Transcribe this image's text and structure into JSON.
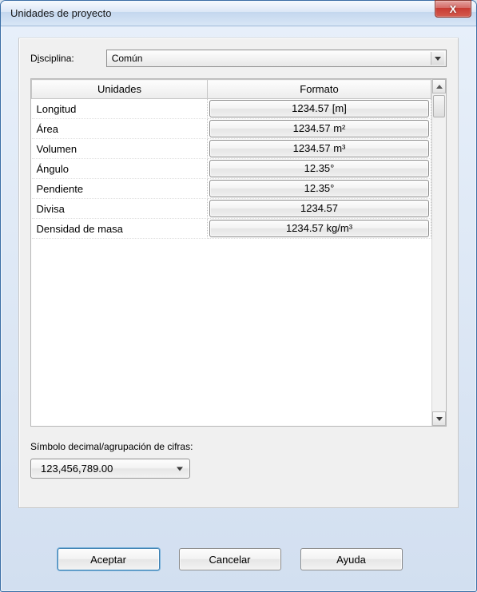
{
  "window": {
    "title": "Unidades de proyecto"
  },
  "discipline": {
    "label_pre": "D",
    "label_ul": "i",
    "label_post": "sciplina:",
    "value": "Común"
  },
  "table": {
    "header_units": "Unidades",
    "header_format": "Formato",
    "rows": [
      {
        "name": "Longitud",
        "format": "1234.57 [m]"
      },
      {
        "name": "Área",
        "format": "1234.57 m²"
      },
      {
        "name": "Volumen",
        "format": "1234.57 m³"
      },
      {
        "name": "Ángulo",
        "format": "12.35°"
      },
      {
        "name": "Pendiente",
        "format": "12.35°"
      },
      {
        "name": "Divisa",
        "format": "1234.57"
      },
      {
        "name": "Densidad de masa",
        "format": "1234.57 kg/m³"
      }
    ]
  },
  "decimal": {
    "label": "Símbolo decimal/agrupación de cifras:",
    "value": "123,456,789.00"
  },
  "buttons": {
    "ok": "Aceptar",
    "cancel": "Cancelar",
    "help": "Ayuda"
  }
}
